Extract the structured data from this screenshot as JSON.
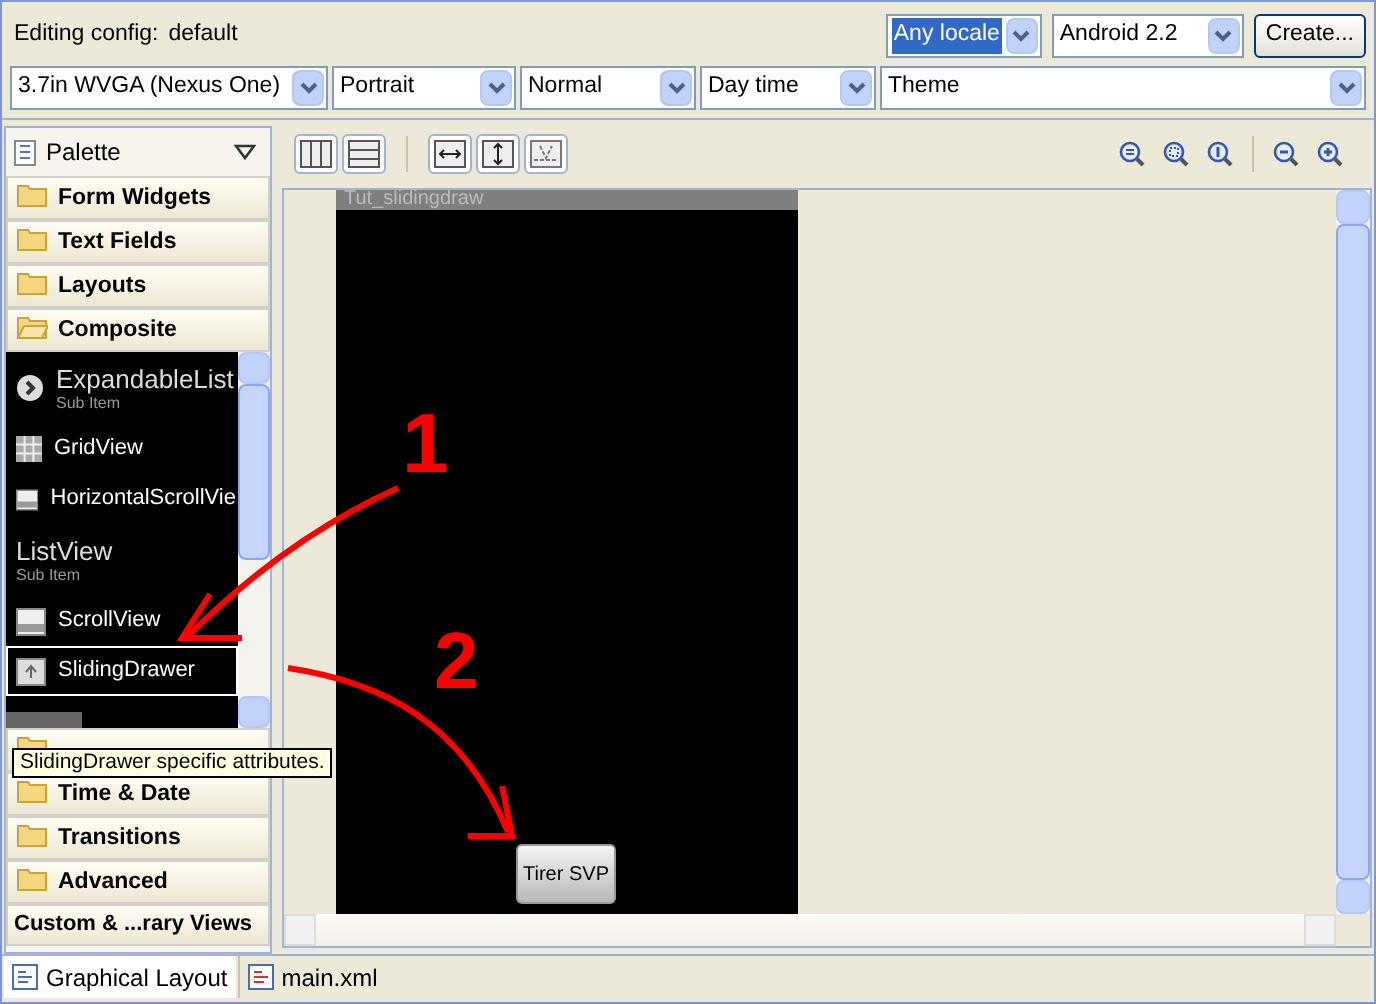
{
  "config": {
    "label": "Editing config:",
    "value": "default",
    "create_button": "Create...",
    "row1": [
      {
        "value": "Any locale",
        "focused": true
      },
      {
        "value": "Android 2.2",
        "focused": false
      }
    ],
    "row2": [
      {
        "value": "3.7in WVGA (Nexus One)",
        "focused": false
      },
      {
        "value": "Portrait",
        "focused": false
      },
      {
        "value": "Normal",
        "focused": false
      },
      {
        "value": "Day time",
        "focused": false
      },
      {
        "value": "Theme",
        "focused": false
      }
    ]
  },
  "palette": {
    "title": "Palette",
    "categories_top": [
      {
        "label": "Form Widgets",
        "expanded": false
      },
      {
        "label": "Text Fields",
        "expanded": false
      },
      {
        "label": "Layouts",
        "expanded": false
      },
      {
        "label": "Composite",
        "expanded": true
      }
    ],
    "items": [
      {
        "kind": "expand",
        "label": "ExpandableList",
        "sublabel": "Sub Item",
        "selected": false
      },
      {
        "kind": "grid",
        "label": "GridView",
        "selected": false
      },
      {
        "kind": "hscroll",
        "label": "HorizontalScrollVie",
        "selected": false
      },
      {
        "kind": "text",
        "label": "ListView",
        "sublabel": "Sub Item",
        "selected": false
      },
      {
        "kind": "scroll",
        "label": "ScrollView",
        "selected": false
      },
      {
        "kind": "drawer",
        "label": "SlidingDrawer",
        "selected": true
      }
    ],
    "categories_bottom": [
      {
        "kind": "covered"
      },
      {
        "label": "Time & Date",
        "expanded": false
      },
      {
        "label": "Transitions",
        "expanded": false
      },
      {
        "label": "Advanced",
        "expanded": false
      }
    ],
    "custom": "Custom & ...rary Views",
    "tooltip": "SlidingDrawer specific attributes."
  },
  "canvas": {
    "app_title": "Tut_slidingdraw",
    "button": "Tirer SVP"
  },
  "annotations": [
    "1",
    "2"
  ],
  "tabs": [
    {
      "label": "Graphical Layout",
      "selected": true
    },
    {
      "label": "main.xml",
      "selected": false
    }
  ]
}
